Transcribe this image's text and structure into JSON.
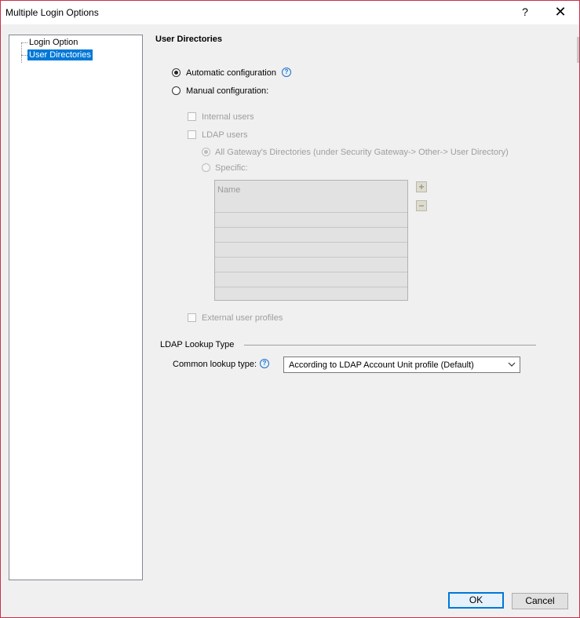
{
  "window": {
    "title": "Multiple Login Options",
    "help_glyph": "?",
    "close_glyph": "✕"
  },
  "tree": {
    "items": [
      {
        "label": "Login Option",
        "selected": false
      },
      {
        "label": "User Directories",
        "selected": true
      }
    ]
  },
  "section": {
    "title": "User Directories"
  },
  "config": {
    "automatic_label": "Automatic configuration",
    "manual_label": "Manual configuration:",
    "selected": "automatic",
    "internal_users_label": "Internal users",
    "ldap_users_label": "LDAP users",
    "all_gateway_label": "All Gateway's Directories (under Security Gateway-> Other-> User Directory)",
    "specific_label": "Specific:",
    "external_profiles_label": "External user profiles"
  },
  "directory_table": {
    "header": "Name",
    "rows": [
      "",
      "",
      "",
      "",
      "",
      ""
    ],
    "add_glyph": "+",
    "remove_glyph": "−"
  },
  "ldap_lookup": {
    "group_title": "LDAP Lookup Type",
    "common_lookup_label": "Common lookup type:",
    "selected_value": "According to LDAP Account Unit profile (Default)"
  },
  "buttons": {
    "ok": "OK",
    "cancel": "Cancel"
  },
  "icons": {
    "help": "help-circle-icon",
    "help_glyph": "?",
    "dropdown": "chevron-down-icon"
  },
  "colors": {
    "selection": "#0078d7",
    "help_icon": "#1e6fc0",
    "window_border": "#c8334a"
  }
}
